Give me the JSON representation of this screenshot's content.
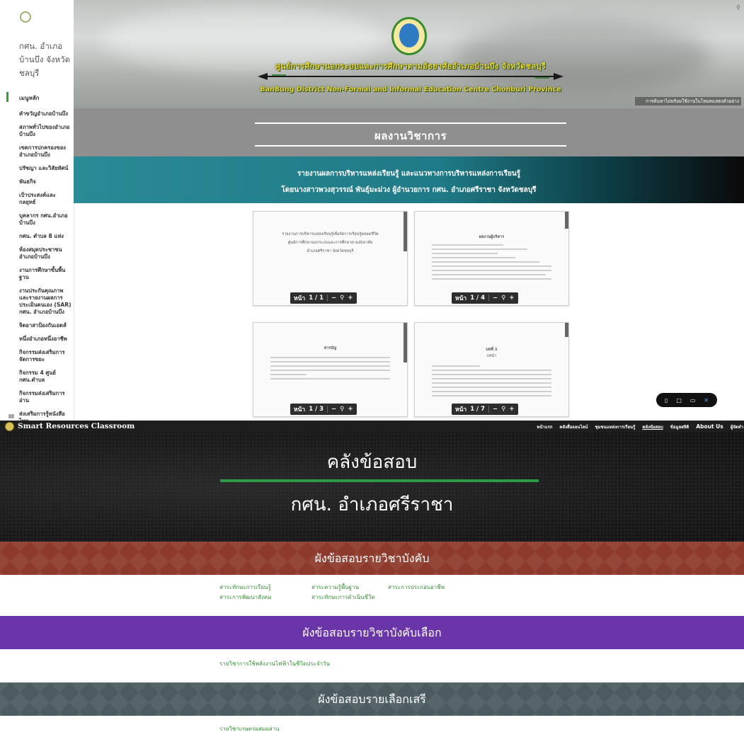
{
  "top_site": {
    "sidebar": {
      "site_name": "กศน. อำเภอบ้านบึง จังหวัดชลบุรี",
      "active_item": "เมนูหลัก",
      "items": [
        "คำขวัญอำเภอบ้านบึง",
        "สภาพทั่วไปของอำเภอบ้านบึง",
        "เขตการปกครองของอำเภอบ้านบึง",
        "ปรัชญา และวิสัยทัศน์",
        "พันธกิจ",
        "เป้าประสงค์และกลยุทธ์",
        "บุคลากร กศน.อำเภอบ้านบึง",
        "กศน. ตำบล 8 แห่ง",
        "ห้องสมุดประชาชนอำเภอบ้านบึง",
        "งานการศึกษาขั้นพื้นฐาน",
        "งานประกันคุณภาพ และรายงานผลการประเมินตนเอง (SAR) กศน. อำเภอบ้านบึง",
        "จิตอาสาป้องกันเอดส์",
        "หนึ่งอำเภอหนึ่งอาชีพ",
        "กิจกรรมส่งเสริมการจัดการขยะ",
        "กิจกรรม 4 ศูนย์ กศน.ตำบล",
        "กิจกรรมส่งเสริมการอ่าน",
        "ส่งเสริมการรู้หนังสือไทย"
      ]
    },
    "header": {
      "title_th": "ศูนย์การศึกษานอกระบบและการศึกษาตามอัธยาศัยอำเภอบ้านบึง จังหวัดชลบุรี",
      "title_en": "BanBung District Non-Formal and Informal Education Centre Chonburi Province",
      "note": "การค้นหาไม่พร้อมใช้งานในโหมดแสดงตัวอย่าง"
    },
    "page_title": "ผลงานวิชาการ",
    "report_line1": "รายงานผลการบริหารแหล่งเรียนรู้ และแนวทางการบริหารแหล่งการเรียนรู้",
    "report_line2": "โดยนางสาวพวงสุวรรณ์ พันธุ์มะม่วง ผู้อำนวยการ กศน. อำเภอศรีราชา จังหวัดชลบุรี",
    "docs": [
      {
        "pager_label": "หน้า",
        "pager_value": "1 / 1",
        "cover_1": "รายงานการบริหารแหล่งเรียนรู้เพื่อจัดการเรียนรู้ตลอดชีวิต",
        "cover_2": "ศูนย์การศึกษานอกระบบและการศึกษาตามอัธยาศัย",
        "cover_3": "อำเภอศรีราชา จังหวัดชลบุรี"
      },
      {
        "pager_label": "หน้า",
        "pager_value": "1 / 4",
        "heading": "ผลงานผู้บริหาร"
      },
      {
        "pager_label": "หน้า",
        "pager_value": "1 / 3",
        "heading": "สารบัญ"
      },
      {
        "pager_label": "หน้า",
        "pager_value": "1 / 7",
        "heading": "บทที่ 1",
        "subheading": "บทนำ"
      }
    ],
    "pager_zoom_out": "−",
    "pager_zoom_in": "+"
  },
  "bottom_site": {
    "brand": "Smart Resources Classroom",
    "nav": [
      "หน้าแรก",
      "คลังสื่อออนไลน์",
      "ชุมชนแหล่งการเรียนรู้",
      "คลังข้อสอบ",
      "ข้อมูลสถิติ",
      "About Us",
      "ผู้จัดทำ"
    ],
    "hero_title": "คลังข้อสอบ",
    "hero_subtitle": "กศน. อำเภอศรีราชา",
    "section_required": "ผังข้อสอบรายวิชาบังคับ",
    "required_links_row1": [
      "สาระทักษะการเรียนรู้",
      "สาระความรู้พื้นฐาน",
      "สาระการประกอบอาชีพ"
    ],
    "required_links_row2": [
      "สาระการพัฒนาสังคม",
      "สาระทักษะการดำเนินชีวิต"
    ],
    "section_elective_required": "ผังข้อสอบรายวิชาบังคับเลือก",
    "elective_required_link": "รายวิชาการใช้พลังงานไฟฟ้าในชีวิตประจำวัน",
    "section_free_elective": "ผังข้อสอบรายเลือกเสรี",
    "free_elective_link": "รายวิชาเกษตรผสมผสาน"
  }
}
